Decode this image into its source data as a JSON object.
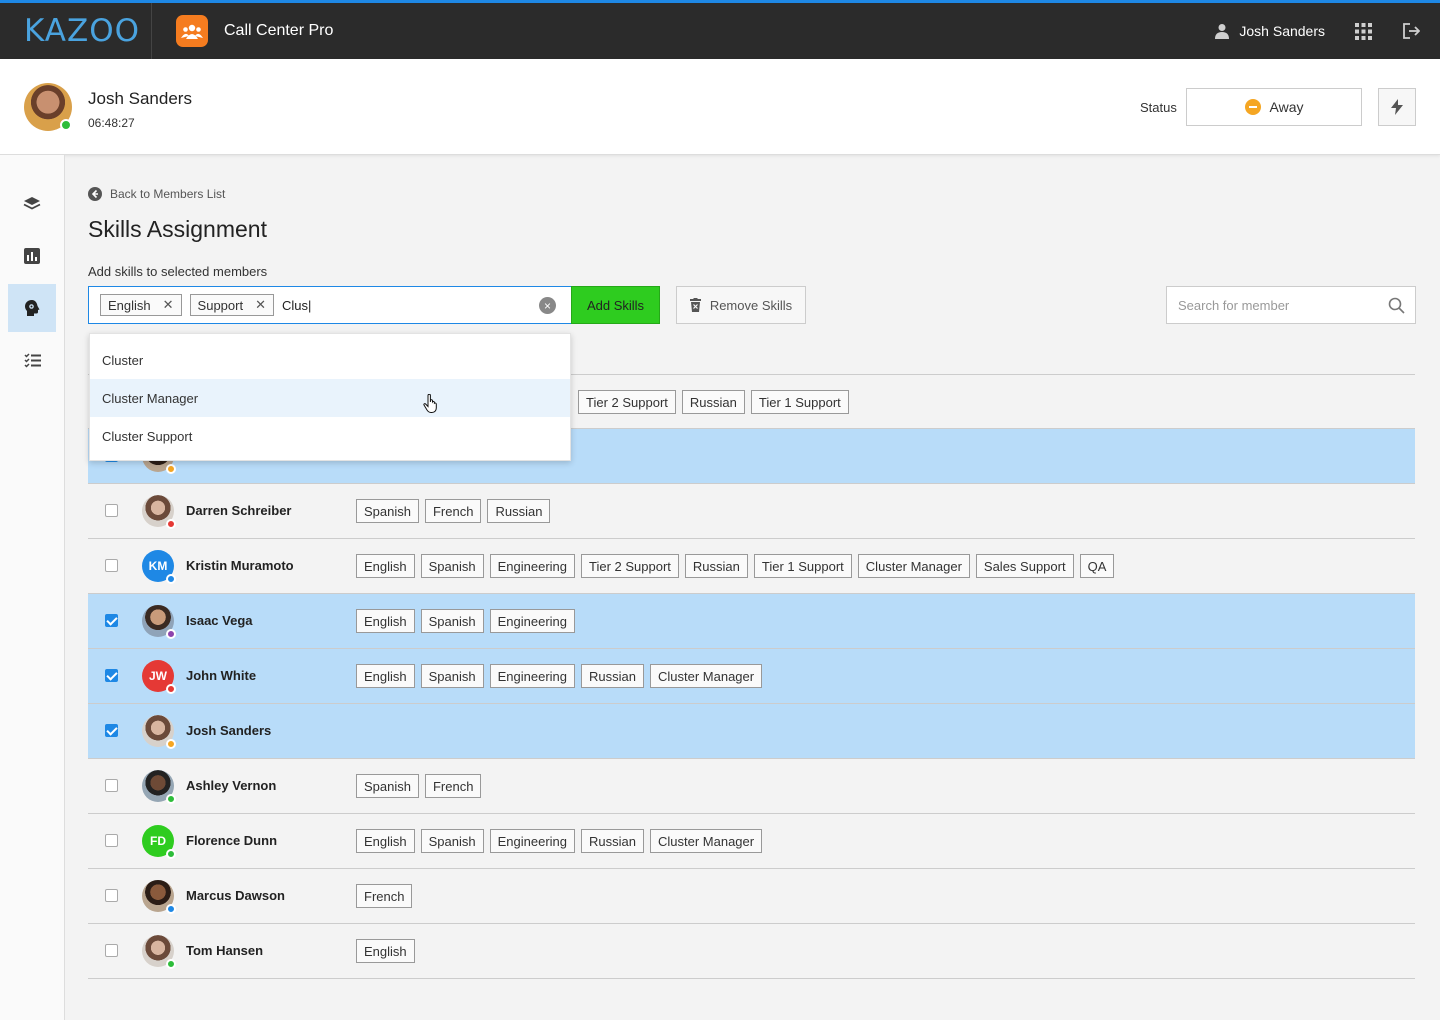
{
  "topbar": {
    "logo": "KAZOO",
    "app_name": "Call Center Pro",
    "user_name": "Josh Sanders"
  },
  "agent": {
    "name": "Josh Sanders",
    "timer": "06:48:27",
    "status_label": "Status",
    "status_value": "Away"
  },
  "page": {
    "back_label": "Back to Members List",
    "title": "Skills Assignment",
    "add_label": "Add skills to selected members"
  },
  "skill_input": {
    "chips": [
      "English",
      "Support"
    ],
    "typed": "Clus|"
  },
  "buttons": {
    "add": "Add Skills",
    "remove": "Remove Skills"
  },
  "search": {
    "placeholder": "Search for member"
  },
  "dropdown": {
    "options": [
      "Cluster",
      "Cluster Manager",
      "Cluster Support"
    ],
    "highlighted": "Cluster Manager"
  },
  "colors": {
    "accent": "#1e88e5",
    "add_button": "#2ecc1f",
    "selected_row": "#b8dcf9",
    "app_icon": "#f57c1f"
  },
  "members": [
    {
      "name": "",
      "initials": "",
      "checked": false,
      "presence": "",
      "skills": [
        "Tier 2 Support",
        "Russian",
        "Tier 1 Support"
      ]
    },
    {
      "name": "",
      "initials": "",
      "checked": true,
      "presence": "orange",
      "skills": []
    },
    {
      "name": "Darren Schreiber",
      "initials": "",
      "checked": false,
      "presence": "red",
      "skills": [
        "Spanish",
        "French",
        "Russian"
      ]
    },
    {
      "name": "Kristin Muramoto",
      "initials": "KM",
      "checked": false,
      "presence": "blue",
      "skills": [
        "English",
        "Spanish",
        "Engineering",
        "Tier 2 Support",
        "Russian",
        "Tier 1 Support",
        "Cluster Manager",
        "Sales Support",
        "QA"
      ]
    },
    {
      "name": "Isaac Vega",
      "initials": "",
      "checked": true,
      "presence": "purple",
      "skills": [
        "English",
        "Spanish",
        "Engineering"
      ]
    },
    {
      "name": "John White",
      "initials": "JW",
      "checked": true,
      "presence": "red",
      "skills": [
        "English",
        "Spanish",
        "Engineering",
        "Russian",
        "Cluster Manager"
      ]
    },
    {
      "name": "Josh Sanders",
      "initials": "",
      "checked": true,
      "presence": "orange",
      "skills": []
    },
    {
      "name": "Ashley Vernon",
      "initials": "",
      "checked": false,
      "presence": "green",
      "skills": [
        "Spanish",
        "French"
      ]
    },
    {
      "name": "Florence Dunn",
      "initials": "FD",
      "checked": false,
      "presence": "green",
      "skills": [
        "English",
        "Spanish",
        "Engineering",
        "Russian",
        "Cluster Manager"
      ]
    },
    {
      "name": "Marcus Dawson",
      "initials": "",
      "checked": false,
      "presence": "blue",
      "skills": [
        "French"
      ]
    },
    {
      "name": "Tom Hansen",
      "initials": "",
      "checked": false,
      "presence": "green",
      "skills": [
        "English"
      ]
    }
  ]
}
